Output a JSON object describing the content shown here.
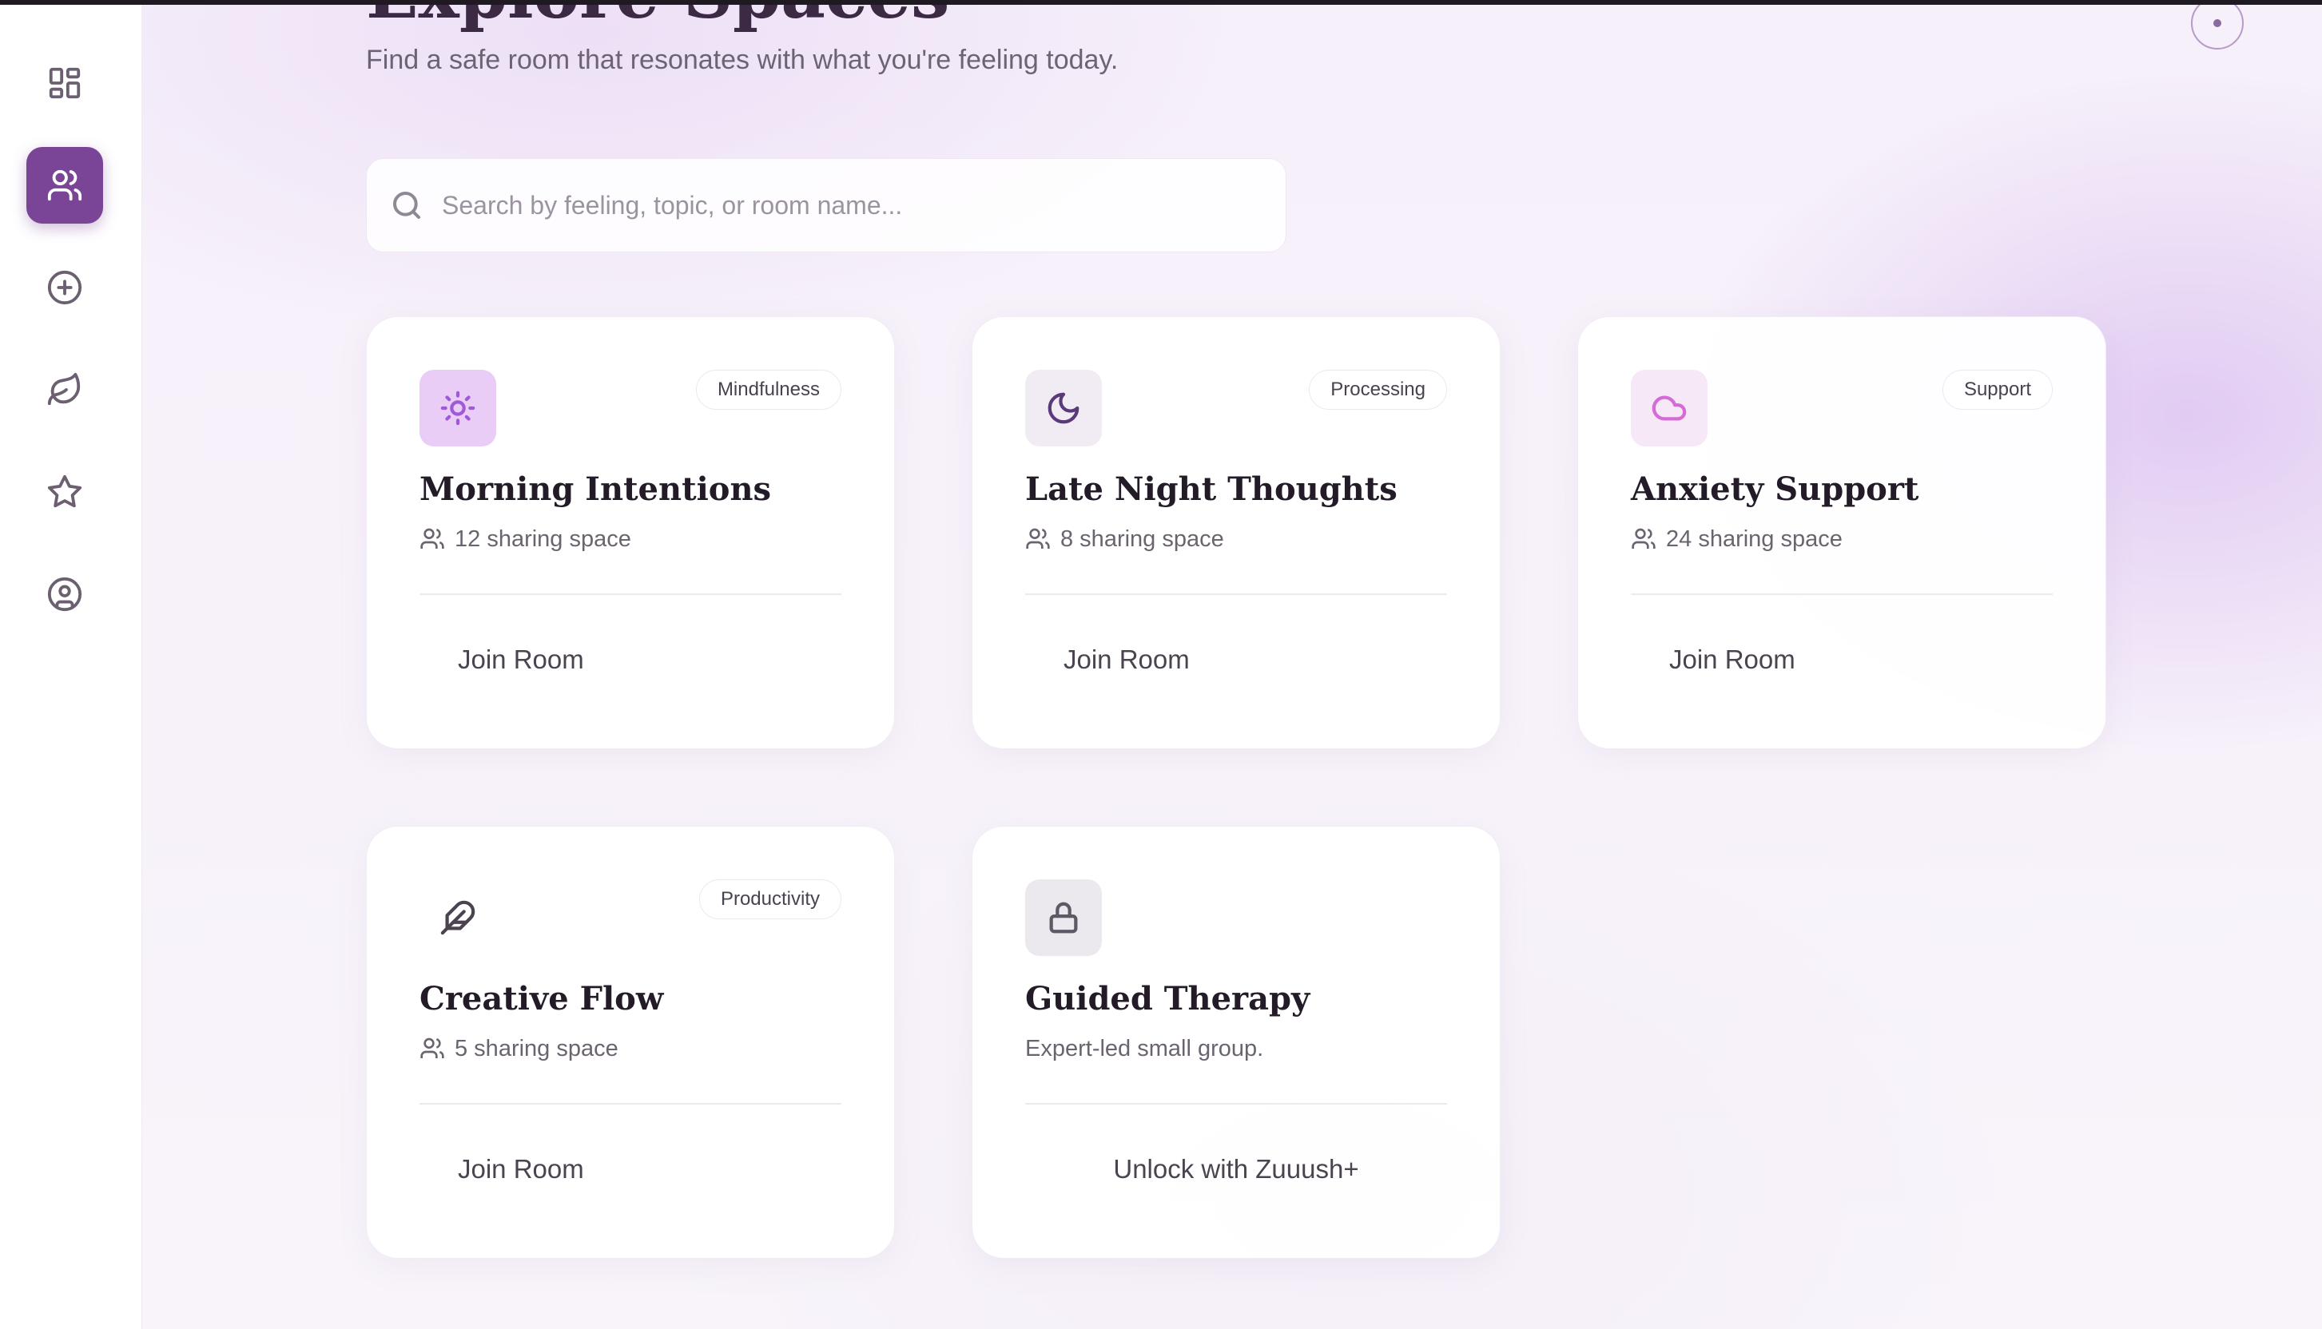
{
  "header": {
    "title": "Explore Spaces",
    "subtitle": "Find a safe room that resonates with what you're feeling today."
  },
  "sidebar": {
    "items": [
      {
        "icon": "dashboard-icon",
        "active": false
      },
      {
        "icon": "users-icon",
        "active": true
      },
      {
        "icon": "plus-circle-icon",
        "active": false
      },
      {
        "icon": "leaf-icon",
        "active": false
      },
      {
        "icon": "star-icon",
        "active": false
      },
      {
        "icon": "user-circle-icon",
        "active": false
      }
    ]
  },
  "search": {
    "placeholder": "Search by feeling, topic, or room name...",
    "value": ""
  },
  "rooms": [
    {
      "icon": "sun-icon",
      "tag": "Mindfulness",
      "title": "Morning Intentions",
      "meta": "12 sharing space",
      "action": "Join Room",
      "icon_bg": "#e9cdf7",
      "icon_color": "#a05ad8"
    },
    {
      "icon": "moon-icon",
      "tag": "Processing",
      "title": "Late Night Thoughts",
      "meta": "8 sharing space",
      "action": "Join Room",
      "icon_bg": "#f1ecf4",
      "icon_color": "#5a3a78"
    },
    {
      "icon": "cloud-icon",
      "tag": "Support",
      "title": "Anxiety Support",
      "meta": "24 sharing space",
      "action": "Join Room",
      "icon_bg": "#f7e8f7",
      "icon_color": "#d46bd6"
    },
    {
      "icon": "feather-icon",
      "tag": "Productivity",
      "title": "Creative Flow",
      "meta": "5 sharing space",
      "action": "Join Room",
      "icon_bg": "#ffffff",
      "icon_color": "#4b4350"
    },
    {
      "icon": "lock-icon",
      "tag": "",
      "title": "Guided Therapy",
      "meta": "Expert-led small group.",
      "action": "Unlock with Zuuush+",
      "icon_bg": "#ebe9ee",
      "icon_color": "#5f5866"
    }
  ],
  "colors": {
    "accent": "#7a4596",
    "card_bg": "#ffffff"
  }
}
